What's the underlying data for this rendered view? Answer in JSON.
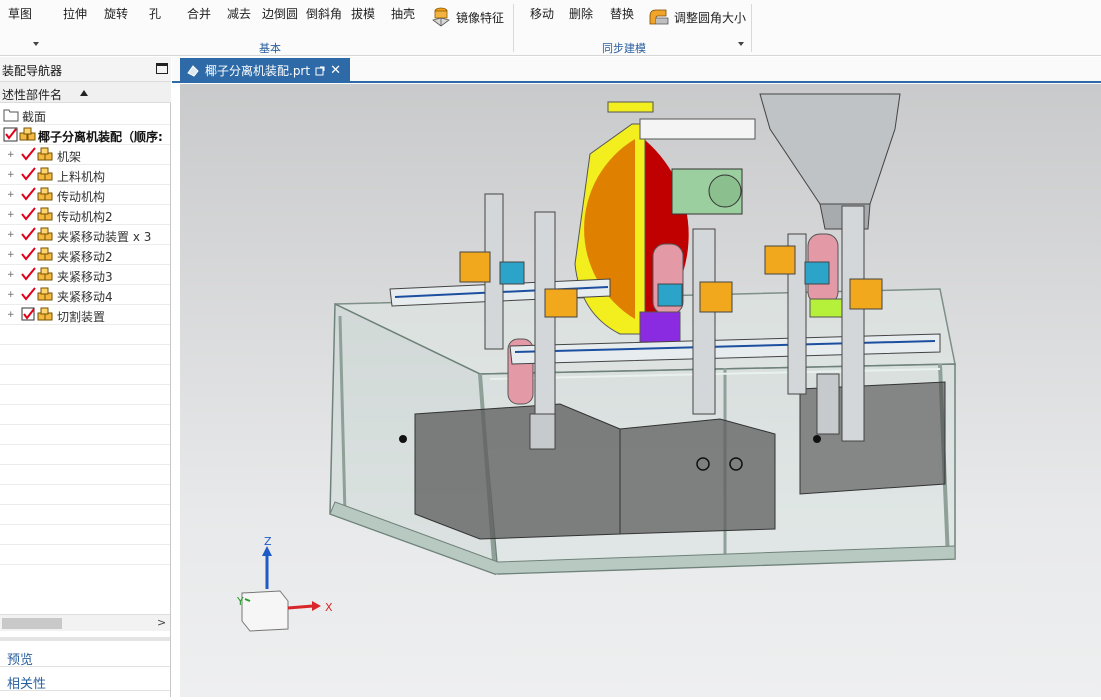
{
  "ribbon": {
    "buttons": {
      "sketch": "草图",
      "extrude": "拉伸",
      "revolve": "旋转",
      "hole": "孔",
      "unite": "合并",
      "subtract": "减去",
      "edge_blend": "边倒圆",
      "chamfer": "倒斜角",
      "draft": "拔模",
      "shell": "抽壳",
      "mirror_feature": "镜像特征",
      "move": "移动",
      "delete": "删除",
      "replace": "替换",
      "resize_blend": "调整圆角大小"
    },
    "groups": {
      "basic": "基本",
      "sync_modeling": "同步建模"
    }
  },
  "navigator": {
    "title": "装配导航器",
    "column_header": "述性部件名",
    "rows": [
      {
        "label": "截面",
        "type": "folder"
      },
      {
        "label": "椰子分离机装配（顺序:",
        "type": "root"
      },
      {
        "label": "机架",
        "type": "part"
      },
      {
        "label": "上料机构",
        "type": "part"
      },
      {
        "label": "传动机构",
        "type": "part"
      },
      {
        "label": "传动机构2",
        "type": "part"
      },
      {
        "label": "夹紧移动装置 x 3",
        "type": "part"
      },
      {
        "label": "夹紧移动2",
        "type": "part"
      },
      {
        "label": "夹紧移动3",
        "type": "part"
      },
      {
        "label": "夹紧移动4",
        "type": "part"
      },
      {
        "label": "切割装置",
        "type": "part-boxed"
      }
    ],
    "panels": {
      "preview": "预览",
      "dependencies": "相关性"
    }
  },
  "tab": {
    "title": "椰子分离机装配.prt"
  },
  "viewport": {
    "triad": {
      "z": "Z",
      "y": "Y",
      "x": "X"
    },
    "colors": {
      "accent": "#2e6aa7",
      "frame": "#b7c9c1",
      "red_disc": "#c00000",
      "yellow_guard": "#f3ef1f"
    }
  }
}
